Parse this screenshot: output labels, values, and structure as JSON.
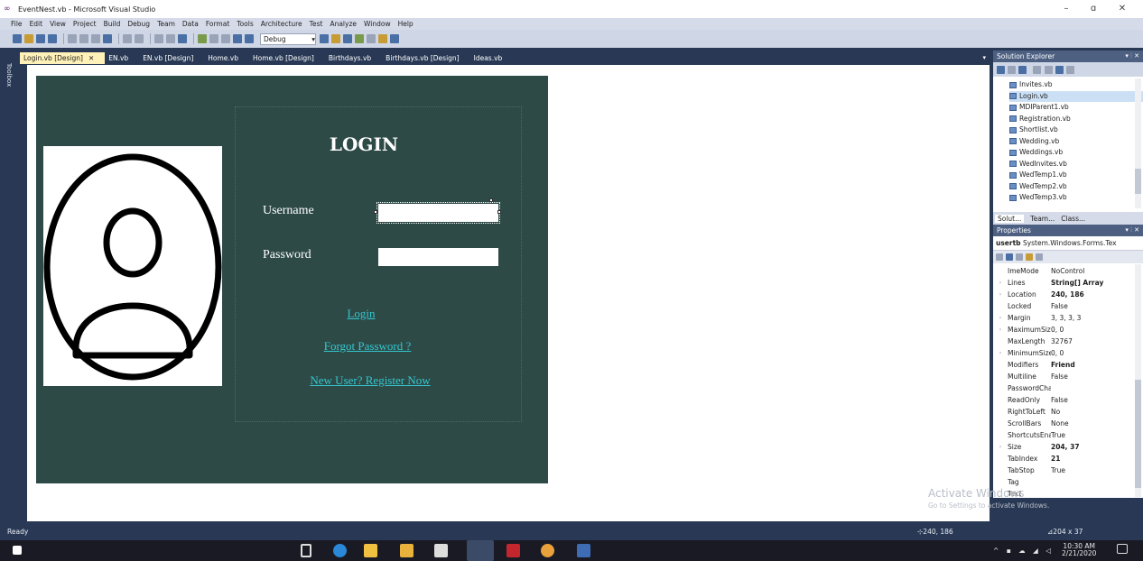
{
  "window": {
    "title": "EventNest.vb - Microsoft Visual Studio",
    "minimize": "–",
    "restore": "ɑ",
    "close": "✕"
  },
  "menu": [
    "File",
    "Edit",
    "View",
    "Project",
    "Build",
    "Debug",
    "Team",
    "Data",
    "Format",
    "Tools",
    "Architecture",
    "Test",
    "Analyze",
    "Window",
    "Help"
  ],
  "toolbar": {
    "config": "Debug"
  },
  "toolbox_label": "Toolbox",
  "tabs": [
    "Login.vb [Design]",
    "EN.vb",
    "EN.vb [Design]",
    "Home.vb",
    "Home.vb [Design]",
    "Birthdays.vb",
    "Birthdays.vb [Design]",
    "Ideas.vb"
  ],
  "form": {
    "heading": "LOGIN",
    "username_label": "Username",
    "password_label": "Password",
    "login_link": "Login",
    "forgot_link": "Forgot Password ?",
    "register_link": "New User? Register Now"
  },
  "solution_explorer": {
    "title": "Solution Explorer",
    "files": [
      "Invites.vb",
      "Login.vb",
      "MDIParent1.vb",
      "Registration.vb",
      "Shortlist.vb",
      "Wedding.vb",
      "Weddings.vb",
      "WedInvites.vb",
      "WedTemp1.vb",
      "WedTemp2.vb",
      "WedTemp3.vb"
    ],
    "selected": "Login.vb",
    "tabs": [
      "Solut...",
      "Team...",
      "Class..."
    ]
  },
  "properties": {
    "title": "Properties",
    "object_name": "usertb",
    "object_type": "System.Windows.Forms.Tex",
    "rows": [
      {
        "name": "ImeMode",
        "value": "NoControl",
        "bold": false,
        "exp": ""
      },
      {
        "name": "Lines",
        "value": "String[] Array",
        "bold": true,
        "exp": "›"
      },
      {
        "name": "Location",
        "value": "240, 186",
        "bold": true,
        "exp": "›"
      },
      {
        "name": "Locked",
        "value": "False",
        "bold": false,
        "exp": ""
      },
      {
        "name": "Margin",
        "value": "3, 3, 3, 3",
        "bold": false,
        "exp": "›"
      },
      {
        "name": "MaximumSize",
        "value": "0, 0",
        "bold": false,
        "exp": "›"
      },
      {
        "name": "MaxLength",
        "value": "32767",
        "bold": false,
        "exp": ""
      },
      {
        "name": "MinimumSize",
        "value": "0, 0",
        "bold": false,
        "exp": "›"
      },
      {
        "name": "Modifiers",
        "value": "Friend",
        "bold": true,
        "exp": ""
      },
      {
        "name": "Multiline",
        "value": "False",
        "bold": false,
        "exp": ""
      },
      {
        "name": "PasswordChar",
        "value": "",
        "bold": false,
        "exp": ""
      },
      {
        "name": "ReadOnly",
        "value": "False",
        "bold": false,
        "exp": ""
      },
      {
        "name": "RightToLeft",
        "value": "No",
        "bold": false,
        "exp": ""
      },
      {
        "name": "ScrollBars",
        "value": "None",
        "bold": false,
        "exp": ""
      },
      {
        "name": "ShortcutsEnabled",
        "value": "True",
        "bold": false,
        "exp": ""
      },
      {
        "name": "Size",
        "value": "204, 37",
        "bold": true,
        "exp": "›"
      },
      {
        "name": "TabIndex",
        "value": "21",
        "bold": true,
        "exp": ""
      },
      {
        "name": "TabStop",
        "value": "True",
        "bold": false,
        "exp": ""
      },
      {
        "name": "Tag",
        "value": "",
        "bold": false,
        "exp": ""
      },
      {
        "name": "Text",
        "value": "",
        "bold": false,
        "exp": ""
      }
    ]
  },
  "watermark": {
    "line1": "Activate Windows",
    "line2": "Go to Settings to activate Windows."
  },
  "status": {
    "text": "Ready",
    "location": "240, 186",
    "size": "204 x 37"
  },
  "clock": {
    "time": "10:30 AM",
    "date": "2/21/2020"
  },
  "colors": {
    "form_bg": "#2d4a47",
    "link": "#35c7cf",
    "ide_chrome": "#293955",
    "active_tab": "#fff1b8"
  }
}
